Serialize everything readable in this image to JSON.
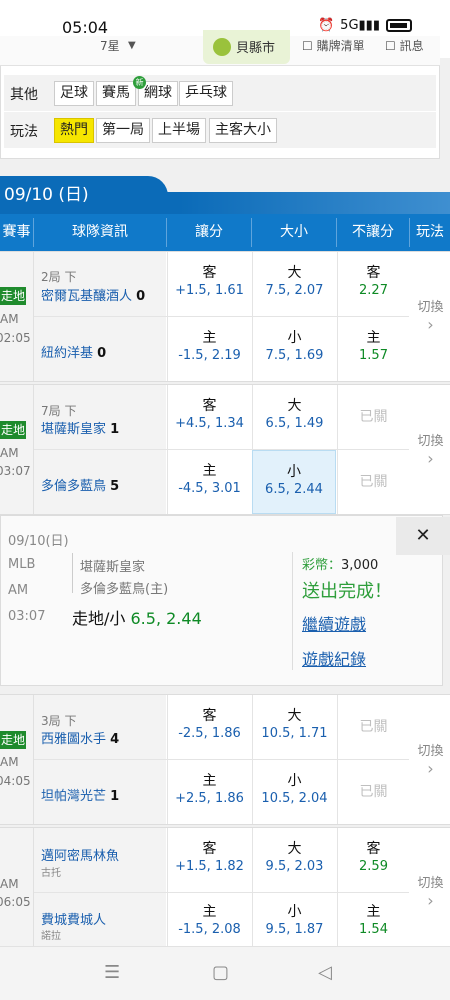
{
  "status": {
    "time": "05:04",
    "network": "5G",
    "icons": [
      "alarm-icon",
      "signal-icon",
      "battery-icon"
    ]
  },
  "top_strip": {
    "items": [
      "7星",
      "貝縣市",
      "購牌清單",
      "訊息"
    ]
  },
  "filters": {
    "other": {
      "label": "其他",
      "options": [
        "足球",
        "賽馬",
        "網球",
        "乒乓球"
      ],
      "new_badge": "新"
    },
    "play": {
      "label": "玩法",
      "options": [
        "熱門",
        "第一局",
        "上半場",
        "主客大小"
      ],
      "active": "熱門"
    }
  },
  "date_banner": "09/10 (日)",
  "table_header": {
    "event": "賽事",
    "team_info": "球隊資訊",
    "handicap": "讓分",
    "over_under": "大小",
    "moneyline": "不讓分",
    "play": "玩法"
  },
  "games": [
    {
      "badge": "走地",
      "am": "AM",
      "time": "02:05",
      "inning": "2局 下",
      "away": {
        "name": "密爾瓦基釀酒人",
        "score": "0"
      },
      "home": {
        "name": "紐約洋基",
        "score": "0"
      },
      "handicap": [
        {
          "side": "客",
          "odds": "+1.5, 1.61"
        },
        {
          "side": "主",
          "odds": "-1.5, 2.19"
        }
      ],
      "total": [
        {
          "side": "大",
          "odds": "7.5, 2.07"
        },
        {
          "side": "小",
          "odds": "7.5, 1.69"
        }
      ],
      "moneyline": [
        {
          "side": "客",
          "odds": "2.27"
        },
        {
          "side": "主",
          "odds": "1.57"
        }
      ],
      "switch_label": "切換"
    },
    {
      "badge": "走地",
      "am": "AM",
      "time": "03:07",
      "inning": "7局 下",
      "away": {
        "name": "堪薩斯皇家",
        "score": "1"
      },
      "home": {
        "name": "多倫多藍鳥",
        "score": "5"
      },
      "handicap": [
        {
          "side": "客",
          "odds": "+4.5, 1.34"
        },
        {
          "side": "主",
          "odds": "-4.5, 3.01"
        }
      ],
      "total": [
        {
          "side": "大",
          "odds": "6.5, 1.49"
        },
        {
          "side": "小",
          "odds": "6.5, 2.44"
        }
      ],
      "moneyline_closed": "已關",
      "switch_label": "切換"
    },
    {
      "badge": "走地",
      "am": "AM",
      "time": "04:05",
      "inning": "3局 下",
      "away": {
        "name": "西雅圖水手",
        "score": "4"
      },
      "home": {
        "name": "坦帕灣光芒",
        "score": "1"
      },
      "handicap": [
        {
          "side": "客",
          "odds": "-2.5, 1.86"
        },
        {
          "side": "主",
          "odds": "+2.5, 1.86"
        }
      ],
      "total": [
        {
          "side": "大",
          "odds": "10.5, 1.71"
        },
        {
          "side": "小",
          "odds": "10.5, 2.04"
        }
      ],
      "moneyline_closed": "已關",
      "switch_label": "切換"
    },
    {
      "am": "AM",
      "time": "06:05",
      "away": {
        "name": "邁阿密馬林魚",
        "pitcher": "古托"
      },
      "home": {
        "name": "費城費城人",
        "pitcher": "諾拉"
      },
      "handicap": [
        {
          "side": "客",
          "odds": "+1.5, 1.82"
        },
        {
          "side": "主",
          "odds": "-1.5, 2.08"
        }
      ],
      "total": [
        {
          "side": "大",
          "odds": "9.5, 2.03"
        },
        {
          "side": "小",
          "odds": "9.5, 1.87"
        }
      ],
      "moneyline": [
        {
          "side": "客",
          "odds": "2.59"
        },
        {
          "side": "主",
          "odds": "1.54"
        }
      ],
      "switch_label": "切換"
    }
  ],
  "popup": {
    "date": "09/10(日)",
    "league": "MLB",
    "am": "AM",
    "time": "03:07",
    "away": "堪薩斯皇家",
    "home": "多倫多藍鳥(主)",
    "bet_label": "走地/小",
    "bet_value": "6.5, 2.44",
    "coin_label": "彩幣：",
    "coin_value": "3,000",
    "done": "送出完成！",
    "continue": "繼續遊戲",
    "history": "遊戲紀錄",
    "close": "✕"
  },
  "nav": {
    "menu": "☰",
    "home": "▢",
    "back": "◁"
  },
  "colors": {
    "header_blue": "#1079c9",
    "odds_green": "#0e8a25",
    "team_blue": "#1a5fae",
    "live_green": "#1f8b2d",
    "active_yellow": "#f6e600"
  }
}
